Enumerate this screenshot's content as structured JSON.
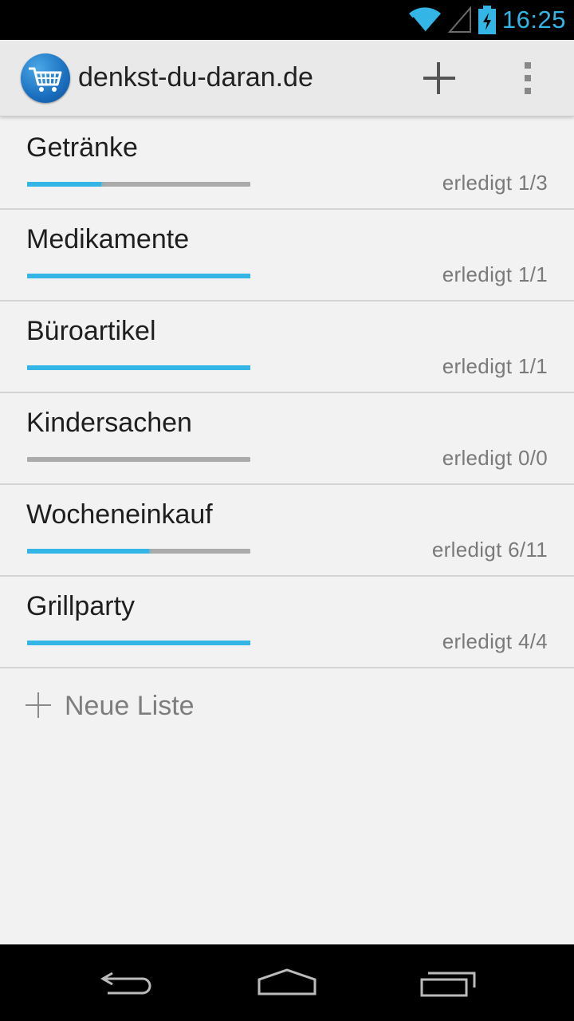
{
  "status_bar": {
    "time": "16:25",
    "icons": [
      "wifi-icon",
      "signal-icon",
      "battery-charging-icon"
    ],
    "accent_color": "#33b5e5"
  },
  "action_bar": {
    "title": "denkst-du-daran.de",
    "logo_icon": "shopping-cart-icon",
    "actions": [
      "add-icon",
      "overflow-menu-icon"
    ]
  },
  "lists": [
    {
      "name": "Getränke",
      "status": "erledigt 1/3",
      "progress": 0.333
    },
    {
      "name": "Medikamente",
      "status": "erledigt 1/1",
      "progress": 1.0
    },
    {
      "name": "Büroartikel",
      "status": "erledigt 1/1",
      "progress": 1.0
    },
    {
      "name": "Kindersachen",
      "status": "erledigt 0/0",
      "progress": 0.0
    },
    {
      "name": "Wocheneinkauf",
      "status": "erledigt 6/11",
      "progress": 0.545
    },
    {
      "name": "Grillparty",
      "status": "erledigt 4/4",
      "progress": 1.0
    }
  ],
  "new_list": {
    "label": "Neue Liste"
  },
  "nav_bar": {
    "buttons": [
      "back-icon",
      "home-icon",
      "recent-apps-icon"
    ]
  }
}
